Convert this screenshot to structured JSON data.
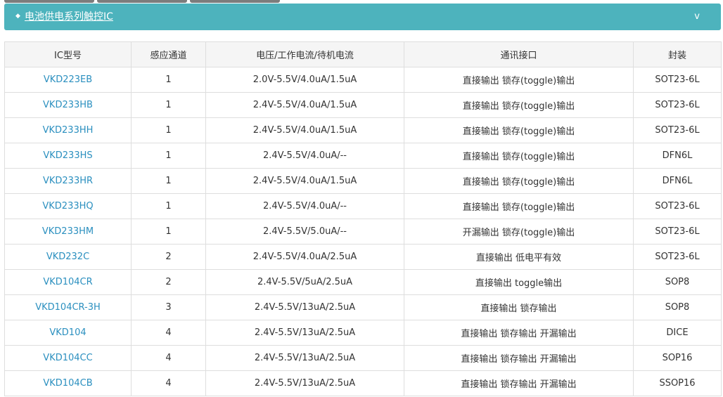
{
  "accordion": {
    "bullet": "◆",
    "title": "电池供电系列触控IC",
    "chevron": "v"
  },
  "table": {
    "headers": [
      "IC型号",
      "感应通道",
      "电压/工作电流/待机电流",
      "通讯接口",
      "封装"
    ],
    "rows": [
      [
        "VKD223EB",
        "1",
        "2.0V-5.5V/4.0uA/1.5uA",
        "直接输出 锁存(toggle)输出",
        "SOT23-6L"
      ],
      [
        "VKD233HB",
        "1",
        "2.4V-5.5V/4.0uA/1.5uA",
        "直接输出 锁存(toggle)输出",
        "SOT23-6L"
      ],
      [
        "VKD233HH",
        "1",
        "2.4V-5.5V/4.0uA/1.5uA",
        "直接输出 锁存(toggle)输出",
        "SOT23-6L"
      ],
      [
        "VKD233HS",
        "1",
        "2.4V-5.5V/4.0uA/--",
        "直接输出 锁存(toggle)输出",
        "DFN6L"
      ],
      [
        "VKD233HR",
        "1",
        "2.4V-5.5V/4.0uA/1.5uA",
        "直接输出 锁存(toggle)输出",
        "DFN6L"
      ],
      [
        "VKD233HQ",
        "1",
        "2.4V-5.5V/4.0uA/--",
        "直接输出 锁存(toggle)输出",
        "SOT23-6L"
      ],
      [
        "VKD233HM",
        "1",
        "2.4V-5.5V/5.0uA/--",
        "开漏输出 锁存(toggle)输出",
        "SOT23-6L"
      ],
      [
        "VKD232C",
        "2",
        "2.4V-5.5V/4.0uA/2.5uA",
        "直接输出 低电平有效",
        "SOT23-6L"
      ],
      [
        "VKD104CR",
        "2",
        "2.4V-5.5V/5uA/2.5uA",
        "直接输出 toggle输出",
        "SOP8"
      ],
      [
        "VKD104CR-3H",
        "3",
        "2.4V-5.5V/13uA/2.5uA",
        "直接输出 锁存输出",
        "SOP8"
      ],
      [
        "VKD104",
        "4",
        "2.4V-5.5V/13uA/2.5uA",
        "直接输出 锁存输出 开漏输出",
        "DICE"
      ],
      [
        "VKD104CC",
        "4",
        "2.4V-5.5V/13uA/2.5uA",
        "直接输出 锁存输出 开漏输出",
        "SOP16"
      ],
      [
        "VKD104CB",
        "4",
        "2.4V-5.5V/13uA/2.5uA",
        "直接输出 锁存输出 开漏输出",
        "SSOP16"
      ]
    ]
  },
  "colors": {
    "accent": "#4db3bd",
    "link": "#2a8fbf",
    "header_bg": "#f5f5f5",
    "border": "#dedede"
  }
}
